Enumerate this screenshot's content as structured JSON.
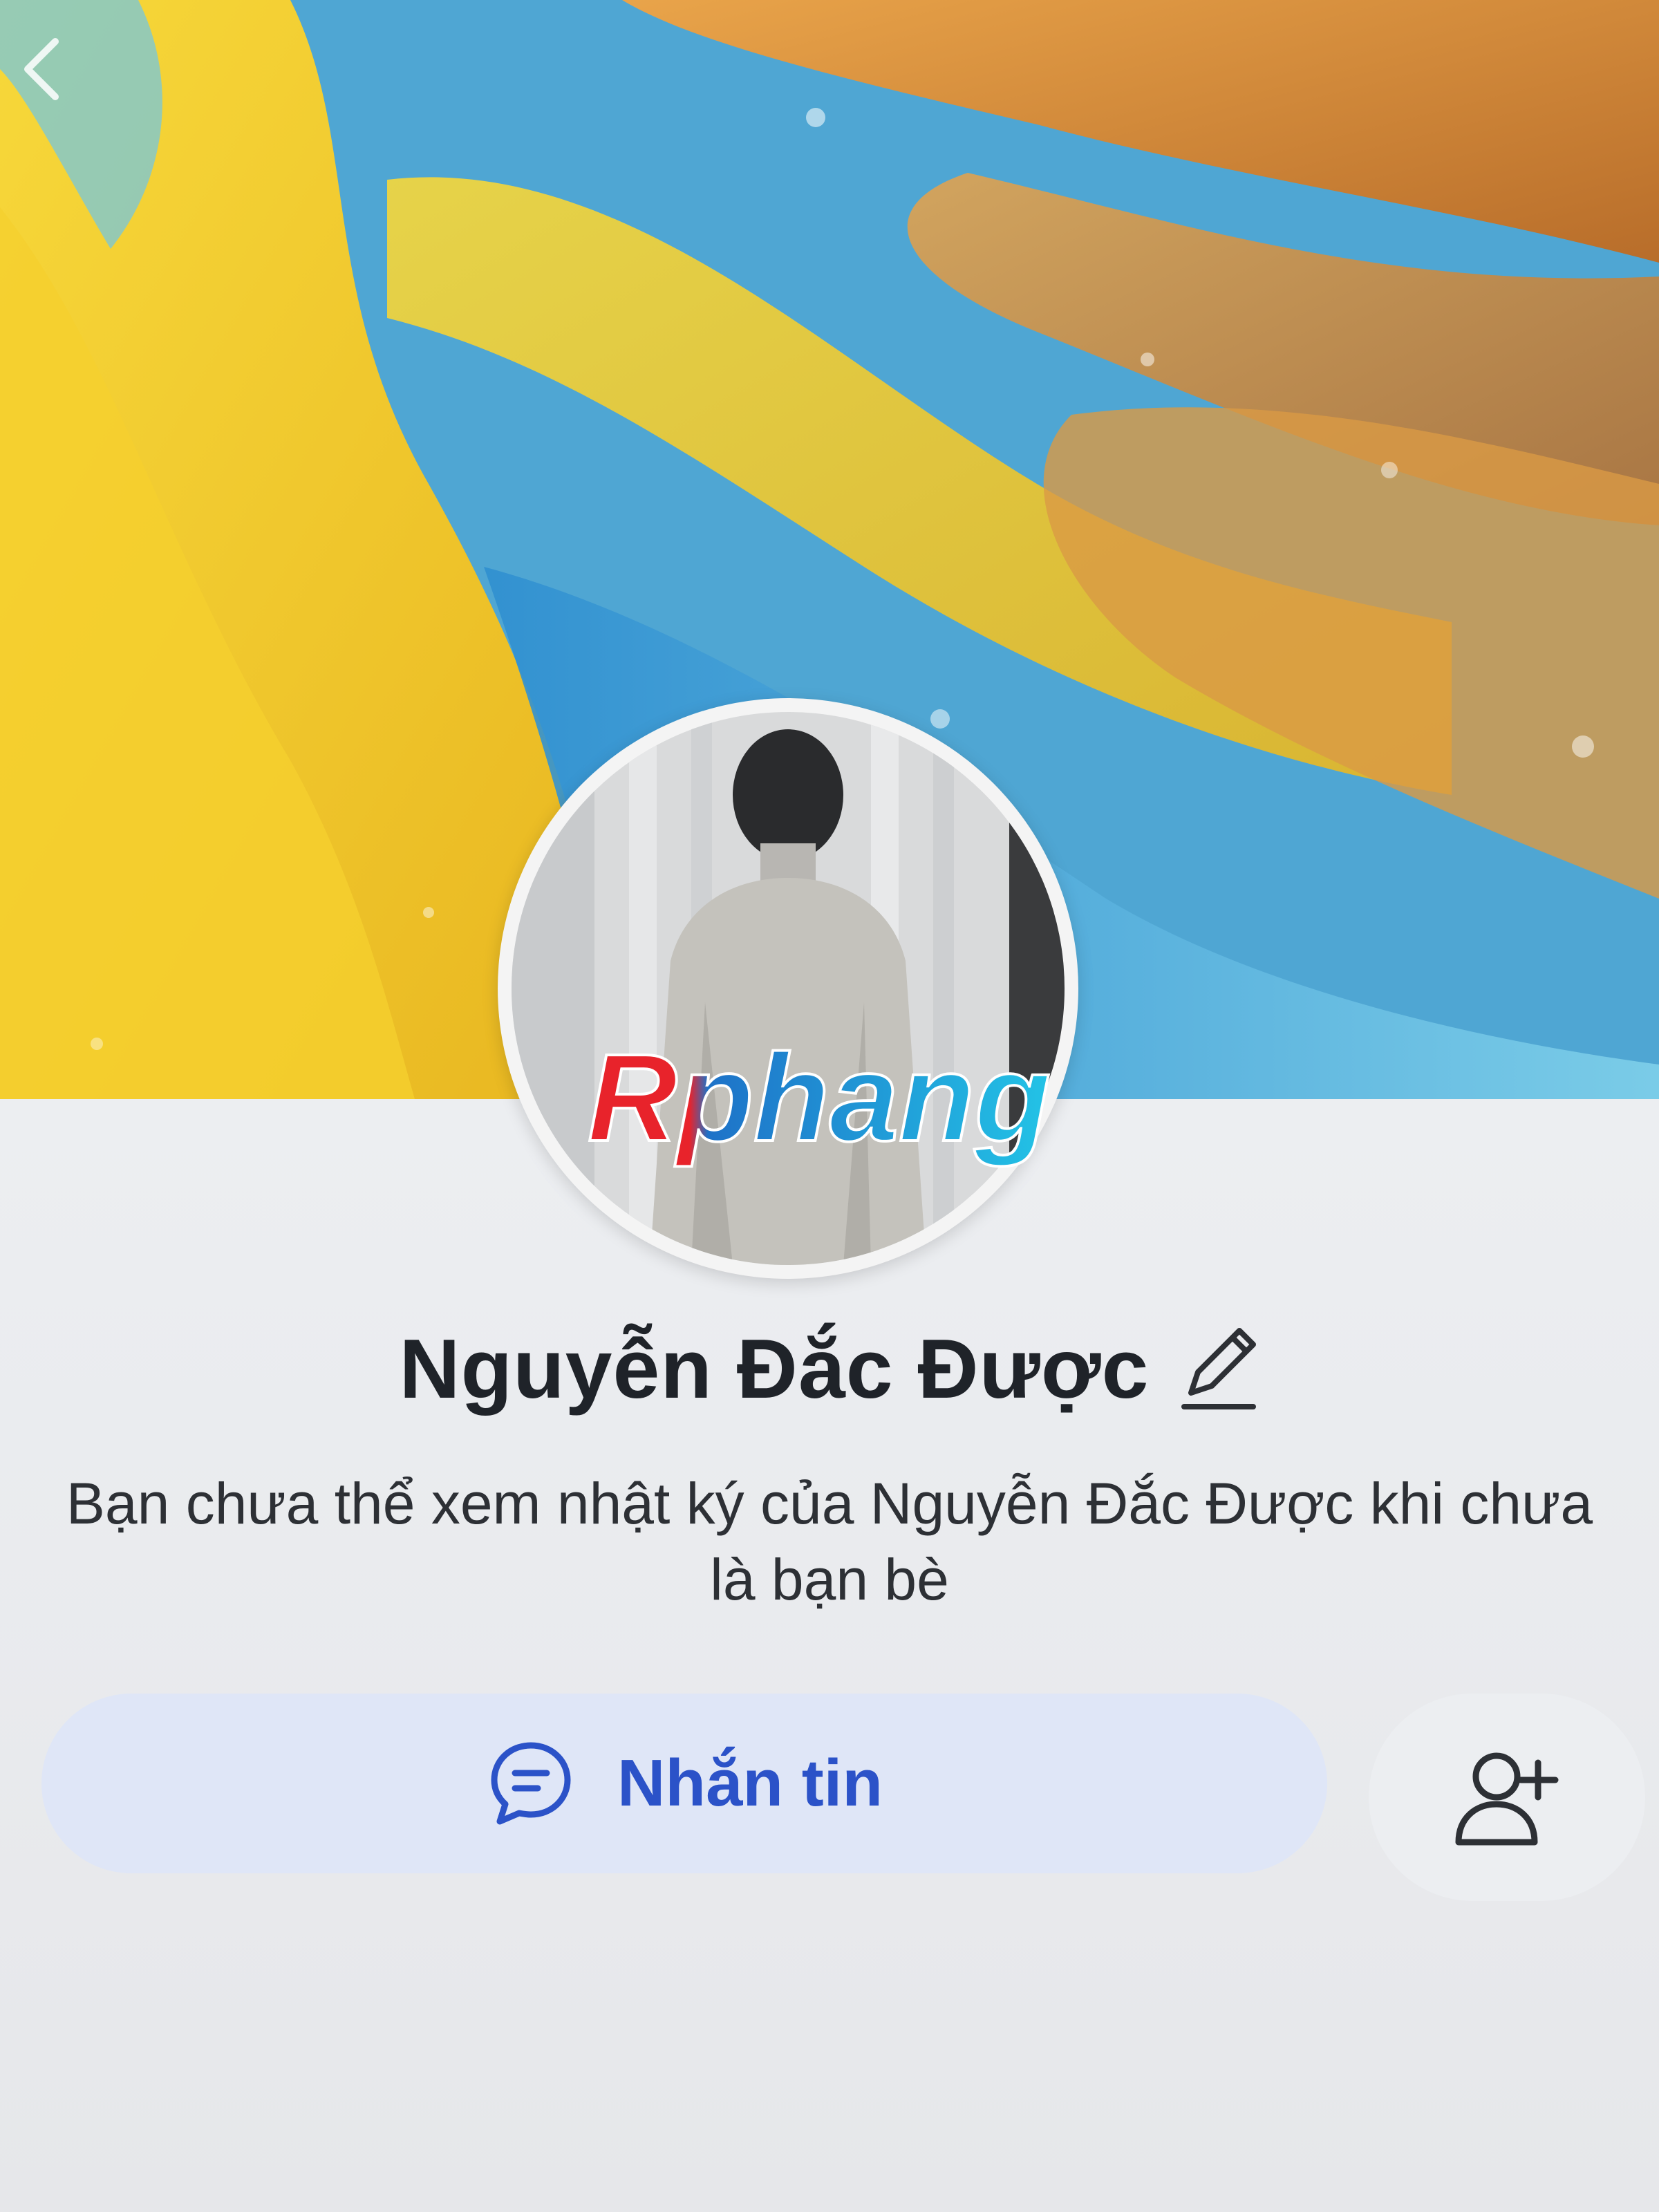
{
  "profile": {
    "name": "Nguyễn Đắc Được",
    "notice": "Bạn chưa thể xem nhật ký của Nguyễn Đắc Được khi chưa là bạn bè"
  },
  "actions": {
    "message_label": "Nhắn tin"
  },
  "watermark": {
    "text": "Rphang"
  },
  "colors": {
    "accent": "#2b52c8",
    "message_button_bg": "#dfe6f7",
    "name_text": "#1f2329"
  }
}
